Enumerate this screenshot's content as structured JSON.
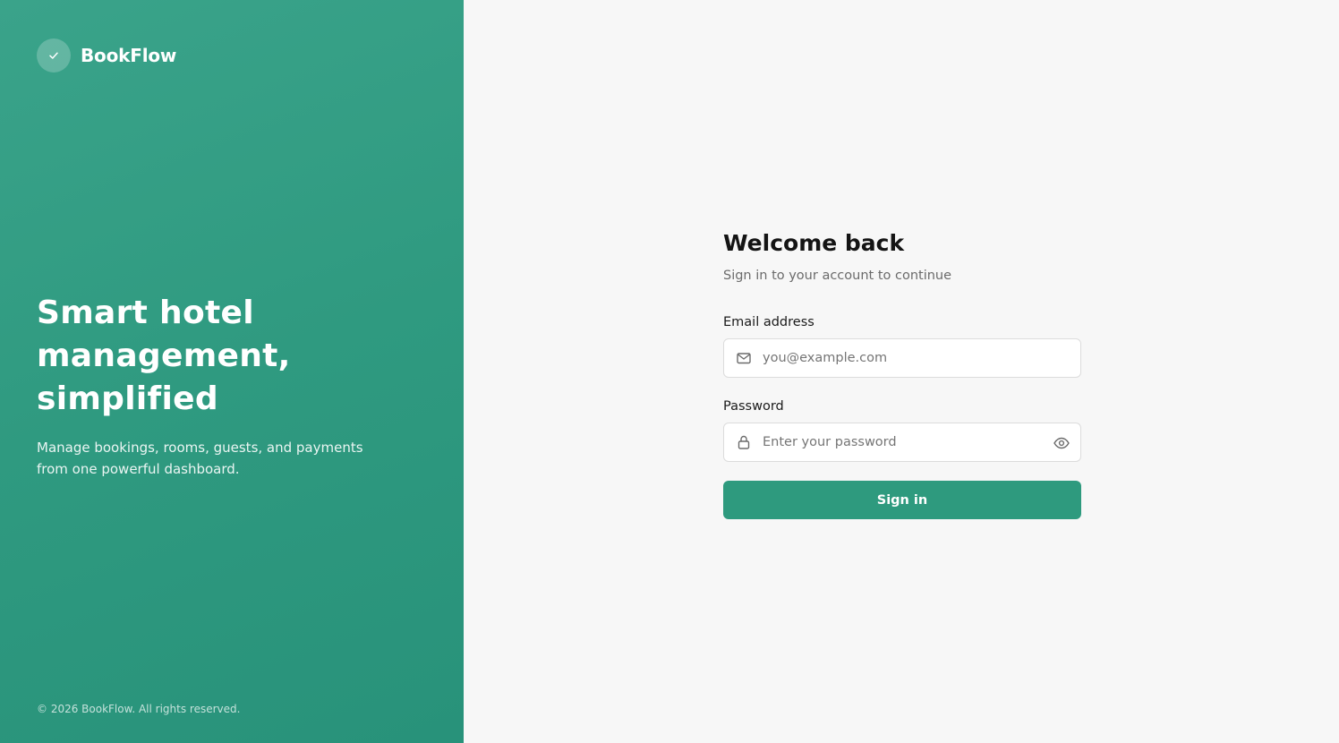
{
  "brand": {
    "name": "BookFlow",
    "logo_icon": "check-icon",
    "headline": "Smart hotel management, simplified",
    "tagline": "Manage bookings, rooms, guests, and payments from one powerful dashboard.",
    "copyright": "© 2026 BookFlow. All rights reserved."
  },
  "login": {
    "title": "Welcome back",
    "subtitle": "Sign in to your account to continue",
    "email": {
      "label": "Email address",
      "placeholder": "you@example.com",
      "value": "",
      "icon": "mail-icon"
    },
    "password": {
      "label": "Password",
      "placeholder": "Enter your password",
      "value": "",
      "icon": "lock-icon",
      "toggle_icon": "eye-icon"
    },
    "submit_label": "Sign in"
  },
  "colors": {
    "brand_green": "#2e9a7e",
    "panel_gradient_start": "#3aa38a",
    "panel_gradient_end": "#28927a",
    "form_background": "#f7f7f7"
  }
}
